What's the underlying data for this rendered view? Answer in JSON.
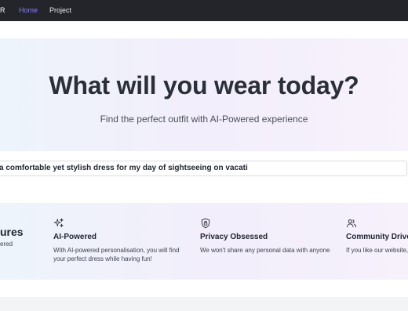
{
  "navbar": {
    "brand": "R",
    "links": [
      {
        "label": "Home",
        "active": true
      },
      {
        "label": "Project",
        "active": false
      }
    ]
  },
  "hero": {
    "title": "What will you wear today?",
    "subtitle": "Find the perfect outfit with AI-Powered experience"
  },
  "prompt": {
    "value": "a comfortable yet stylish dress for my day of sightseeing on vacati"
  },
  "features": {
    "heading": "ures",
    "subheading": "ered",
    "items": [
      {
        "icon": "sparkles-icon",
        "title": "AI-Powered",
        "desc_line1": "With AI-powered personalisation, you will find",
        "desc_line2": "your perfect dress while having fun!"
      },
      {
        "icon": "shield-lock-icon",
        "title": "Privacy Obsessed",
        "desc_line1": "We won't share any personal data with anyone",
        "desc_line2": ""
      },
      {
        "icon": "users-icon",
        "title": "Community Driven",
        "desc_line1": "If you like our website, ",
        "desc_line2": ""
      }
    ]
  },
  "colors": {
    "nav_bg": "#23252b",
    "active_link": "#8b7bff",
    "title_text": "#2b2f38"
  }
}
